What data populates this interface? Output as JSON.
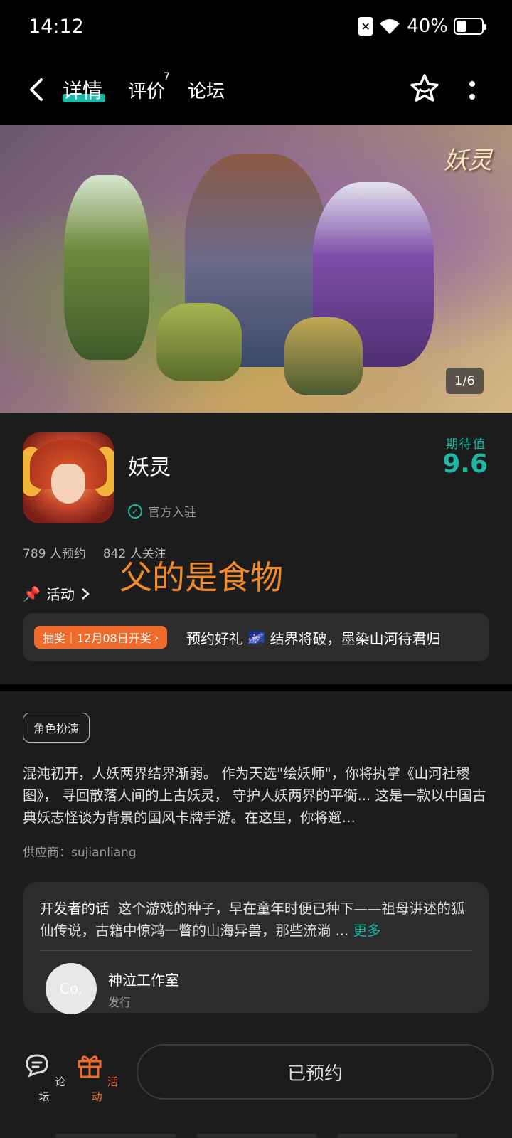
{
  "status_bar": {
    "time": "14:12",
    "battery": "40%"
  },
  "nav": {
    "tabs": [
      "详情",
      "评价",
      "论坛"
    ],
    "review_count": "7"
  },
  "hero": {
    "logo": "妖灵",
    "counter": "1/6"
  },
  "app": {
    "name": "妖灵",
    "official_label": "官方入驻",
    "anticipation_label": "期待值",
    "anticipation_score": "9.6",
    "reservations": "789 人预约",
    "followers": "842 人关注"
  },
  "overlay_text": "父的是食物",
  "activity": {
    "label": "活动",
    "lottery_tag": "抽奖｜12月08日开奖",
    "promo_text": "预约好礼 🌌 结界将破，墨染山河待君归"
  },
  "detail": {
    "genre": "角色扮演",
    "description": "混沌初开，人妖两界结界渐弱。 作为天选\"绘妖师\"，你将执掌《山河社稷图》， 寻回散落人间的上古妖灵， 守护人妖两界的平衡... 这是一款以中国古典妖志怪谈为背景的国风卡牌手游。在这里，你将邂…",
    "supplier": "供应商：sujianliang"
  },
  "developer": {
    "title": "开发者的话",
    "words": "这个游戏的种子，早在童年时便已种下——祖母讲述的狐仙传说，古籍中惊鸿一瞥的山海异兽，那些流淌 ...",
    "more": "更多",
    "studio_name": "神泣工作室",
    "studio_role": "发行",
    "avatar_text": "Co."
  },
  "bottom": {
    "forum": "论坛",
    "activity": "活动",
    "reserve_button": "已预约"
  },
  "colors": {
    "accent": "#1bb8a4",
    "orange": "#f06a2c",
    "background": "#1c1c1c"
  }
}
